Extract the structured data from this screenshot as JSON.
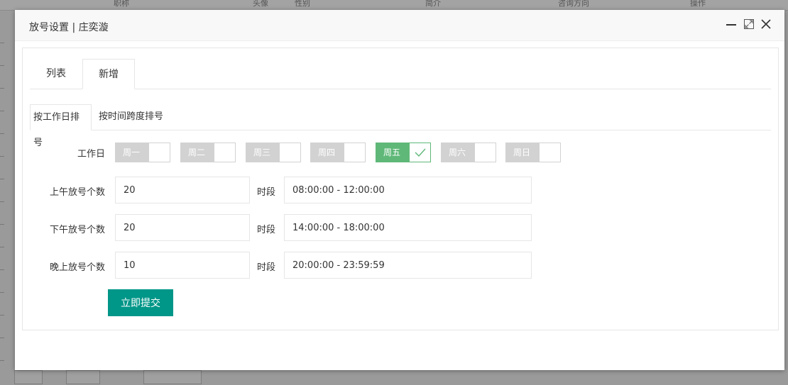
{
  "background": {
    "columns": [
      "职称",
      "头像",
      "性别",
      "简介",
      "咨询方向",
      "操作"
    ]
  },
  "modal": {
    "title": "放号设置 | 庄奕漩",
    "controls": {
      "minimize": "minimize-icon",
      "maximize": "maximize-icon",
      "close": "close-icon"
    }
  },
  "tabs": [
    {
      "label": "列表",
      "active": false
    },
    {
      "label": "新增",
      "active": true
    }
  ],
  "subtabs": [
    {
      "label": "按工作日排号",
      "active": true
    },
    {
      "label": "按时间跨度排号",
      "active": false
    }
  ],
  "form": {
    "workday_label": "工作日",
    "days": [
      {
        "label": "周一",
        "checked": false
      },
      {
        "label": "周二",
        "checked": false
      },
      {
        "label": "周三",
        "checked": false
      },
      {
        "label": "周四",
        "checked": false
      },
      {
        "label": "周五",
        "checked": true
      },
      {
        "label": "周六",
        "checked": false
      },
      {
        "label": "周日",
        "checked": false
      }
    ],
    "slot_label": "时段",
    "rows": [
      {
        "label": "上午放号个数",
        "count": "20",
        "time": "08:00:00 - 12:00:00"
      },
      {
        "label": "下午放号个数",
        "count": "20",
        "time": "14:00:00 - 18:00:00"
      },
      {
        "label": "晚上放号个数",
        "count": "10",
        "time": "20:00:00 - 23:59:59"
      }
    ],
    "submit_label": "立即提交"
  },
  "colors": {
    "accent": "#009688",
    "checked": "#5fb878",
    "unchecked": "#d2d2d2"
  }
}
